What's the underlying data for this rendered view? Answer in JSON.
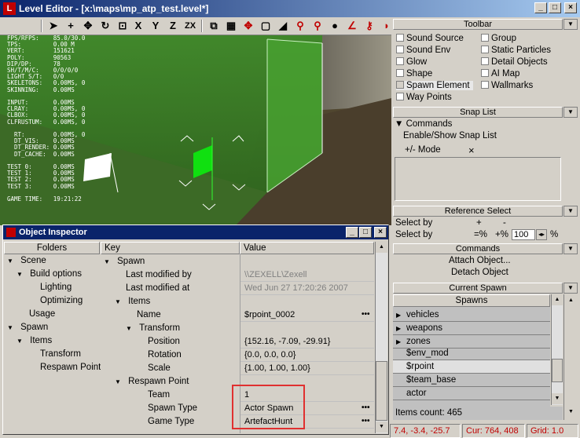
{
  "window": {
    "title": "Level Editor - [x:\\maps\\mp_atp_test.level*]",
    "app_icon": "L"
  },
  "viewport_stats": {
    "lines": [
      "FPS/RFPS:    85.0/30.0",
      "TPS:         0.00 M",
      "VERT:        151621",
      "POLY:        90563",
      "DIP/DP:      78",
      "SH/T/M/C:    0/0/0/0",
      "LIGHT S/T:   0/0",
      "SKELETONS:   0.00MS, 0",
      "SKINNING:    0.00MS",
      "",
      "INPUT:       0.00MS",
      "CLRAY:       0.00MS, 0",
      "CLBOX:       0.00MS, 0",
      "CLFRUSTUM:   0.00MS, 0",
      "",
      "  RT:        0.00MS, 0",
      "  DT_VIS:    0.00MS",
      "  DT_RENDER: 0.00MS",
      "  DT_CACHE:  0.00MS",
      "",
      "TEST 0:      0.00MS",
      "TEST 1:      0.00MS",
      "TEST 2:      0.00MS",
      "TEST 3:      0.00MS",
      "",
      "GAME TIME:   19:21:22"
    ]
  },
  "toolbar_panel": {
    "header": "Toolbar",
    "items_left": [
      "Sound Source",
      "Sound Env",
      "Glow",
      "Shape",
      "Spawn Element",
      "Way Points"
    ],
    "items_right": [
      "Group",
      "Static Particles",
      "Detail Objects",
      "AI Map",
      "Wallmarks"
    ]
  },
  "snap_list": {
    "header": "Snap List",
    "commands_label": "Commands",
    "enable_show": "Enable/Show Snap List",
    "mode_label": "+/- Mode",
    "x": "×"
  },
  "reference_select": {
    "header": "Reference Select",
    "select_by_1": "Select by",
    "plus": "+",
    "minus": "-",
    "select_by_2": "Select by",
    "eq_pct": "=%",
    "plus_pct": "+%",
    "value": "100",
    "pct": "%"
  },
  "commands": {
    "header": "Commands",
    "attach": "Attach Object...",
    "detach": "Detach Object"
  },
  "current_spawn": {
    "header": "Current Spawn",
    "spawns_header": "Spawns",
    "items": [
      "vehicles",
      "weapons",
      "zones",
      "$env_mod",
      "$rpoint",
      "$team_base",
      "actor"
    ],
    "count": "Items count: 465"
  },
  "object_inspector": {
    "title": "Object Inspector",
    "folders_header": "Folders",
    "key_header": "Key",
    "value_header": "Value",
    "folders": [
      "Scene",
      "Build options",
      "Lighting",
      "Optimizing",
      "Usage",
      "Spawn",
      "Items",
      "Transform",
      "Respawn Point"
    ],
    "rows": [
      {
        "key": "Spawn",
        "value": ""
      },
      {
        "key": "Last modified by",
        "value": "\\\\ZEXELL\\Zexell"
      },
      {
        "key": "Last modified at",
        "value": "Wed Jun 27 17:20:26 2007"
      },
      {
        "key": "Items",
        "value": ""
      },
      {
        "key": "Name",
        "value": "$rpoint_0002"
      },
      {
        "key": "Transform",
        "value": ""
      },
      {
        "key": "Position",
        "value": "{152.16, -7.09, -29.91}"
      },
      {
        "key": "Rotation",
        "value": "{0.0, 0.0, 0.0}"
      },
      {
        "key": "Scale",
        "value": "{1.00, 1.00, 1.00}"
      },
      {
        "key": "Respawn Point",
        "value": ""
      },
      {
        "key": "Team",
        "value": "1"
      },
      {
        "key": "Spawn Type",
        "value": "Actor Spawn"
      },
      {
        "key": "Game Type",
        "value": "ArtefactHunt"
      }
    ]
  },
  "status": {
    "coords": "7.4, -3.4, -25.7",
    "cursor": "Cur: 764, 408",
    "grid": "Grid: 1.0"
  },
  "colors": {
    "title_blue": "#0a246a",
    "highlight_red": "#e03030"
  }
}
